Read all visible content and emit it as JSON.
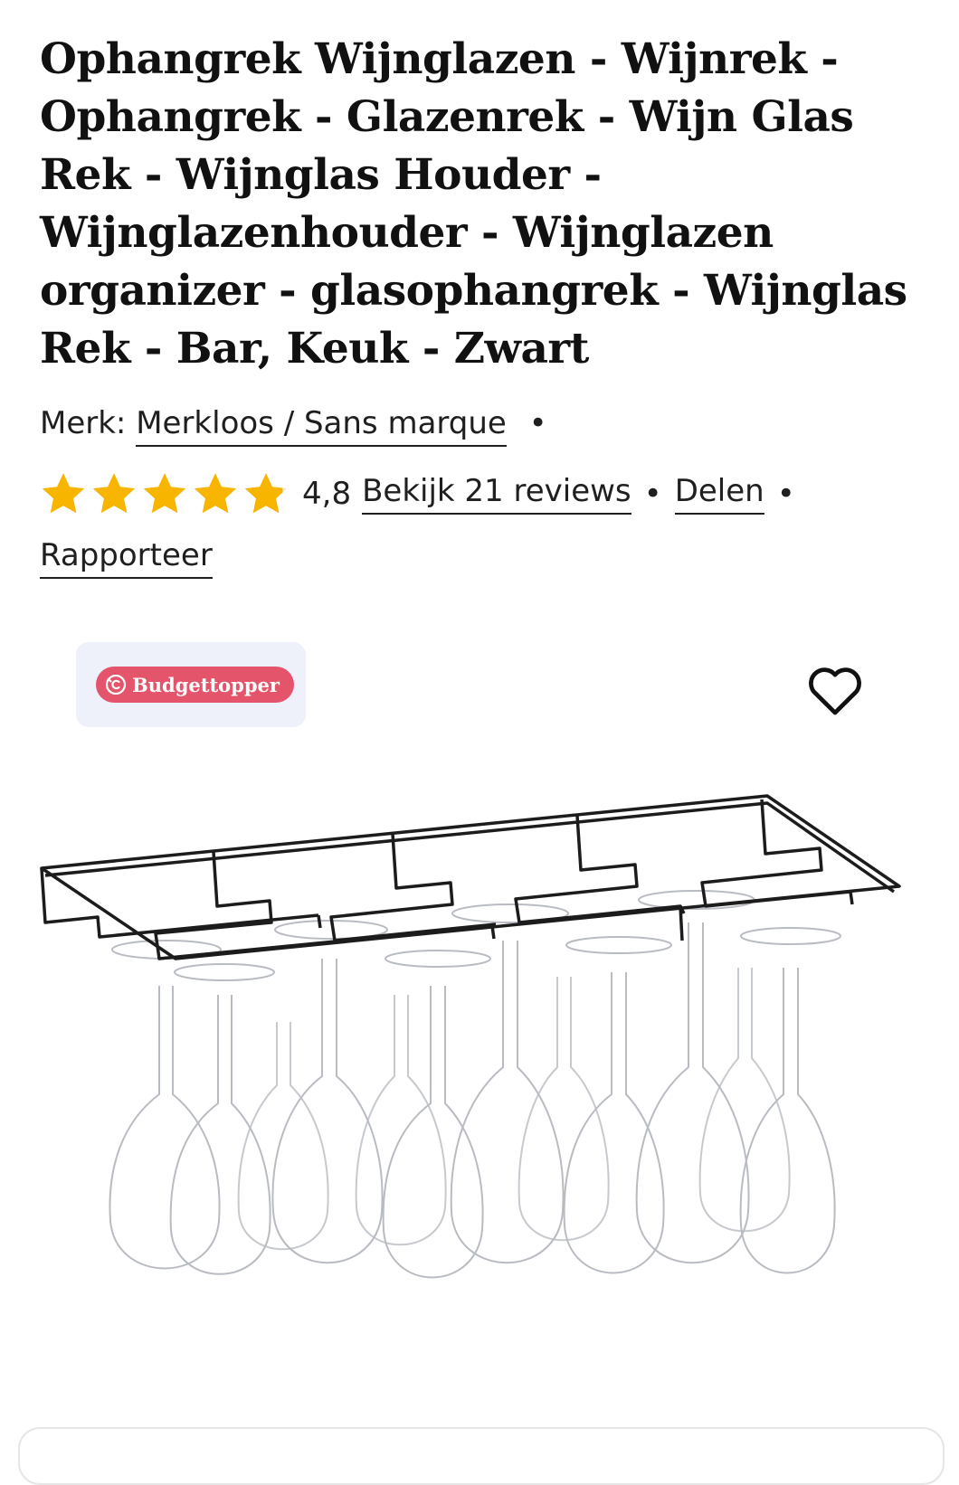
{
  "product": {
    "title": "Ophangrek Wijnglazen - Wijnrek - Ophangrek - Glazenrek - Wijn Glas Rek - Wijnglas Houder - Wijnglazenhouder - Wijnglazen organizer - glasophangrek - Wijnglas Rek - Bar, Keuk - Zwart",
    "brand_label": "Merk:",
    "brand_name": "Merkloos / Sans marque",
    "rating": "4,8",
    "rating_stars": 4.8,
    "reviews_link": "Bekijk 21 reviews",
    "share_link": "Delen",
    "report_link": "Rapporteer",
    "separator": "•"
  },
  "badge": {
    "label": "Budgettopper"
  },
  "colors": {
    "star": "#f7b500",
    "badge_bg": "#e4546a",
    "badge_box_bg": "#eef1fa"
  },
  "icons": [
    "star-icon",
    "budgettopper-icon",
    "heart-icon"
  ]
}
